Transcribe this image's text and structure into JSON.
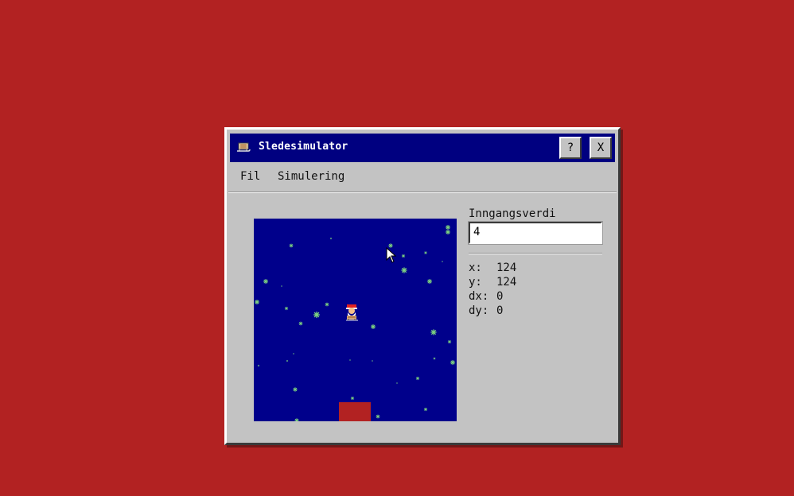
{
  "window": {
    "title": "Sledesimulator",
    "title_icon": "sled-icon",
    "help_label": "?",
    "close_label": "X"
  },
  "menu": {
    "items": [
      "Fil",
      "Simulering"
    ]
  },
  "panel": {
    "input_label": "Inngangsverdi",
    "input_value": "4",
    "readouts": [
      {
        "key": "x:",
        "value": "124"
      },
      {
        "key": "y:",
        "value": "124"
      },
      {
        "key": "dx:",
        "value": "0"
      },
      {
        "key": "dy:",
        "value": "0"
      }
    ]
  },
  "colors": {
    "desktop": "#b22222",
    "canvas": "#00008b",
    "snow": "#7fd67f",
    "target": "#b22222",
    "titlebar": "#000080"
  },
  "icons": {
    "snowflake": "snowflake-icon",
    "santa": "santa-sled-icon",
    "cursor": "mouse-cursor-icon"
  }
}
